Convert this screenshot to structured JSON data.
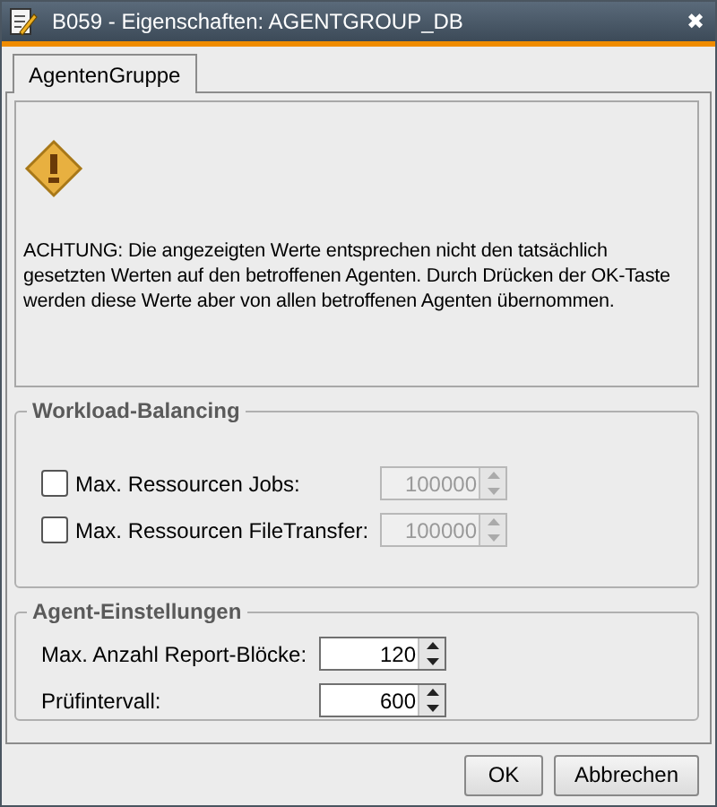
{
  "window": {
    "title": "B059 - Eigenschaften: AGENTGROUP_DB",
    "close": "✖"
  },
  "tabs": [
    {
      "label": "AgentenGruppe",
      "selected": true
    }
  ],
  "warning": {
    "text": "ACHTUNG: Die angezeigten Werte entsprechen nicht den tatsächlich gesetzten Werten auf den betroffenen Agenten. Durch Drücken der OK-Taste werden diese Werte aber von allen betroffenen Agenten übernommen."
  },
  "groups": [
    {
      "title": "Workload-Balancing",
      "kind": "checks",
      "rows": [
        {
          "label": "Max. Ressourcen Jobs:",
          "checked": false,
          "value": "100000",
          "disabled": true
        },
        {
          "label": "Max. Ressourcen FileTransfer:",
          "checked": false,
          "value": "100000",
          "disabled": true
        }
      ]
    },
    {
      "title": "Agent-Einstellungen",
      "kind": "plain",
      "rows": [
        {
          "label": "Max. Anzahl Report-Blöcke:",
          "value": "120",
          "disabled": false
        },
        {
          "label": "Prüfintervall:",
          "value": "600",
          "disabled": false
        }
      ]
    }
  ],
  "buttons": [
    "OK",
    "Abbrechen"
  ]
}
